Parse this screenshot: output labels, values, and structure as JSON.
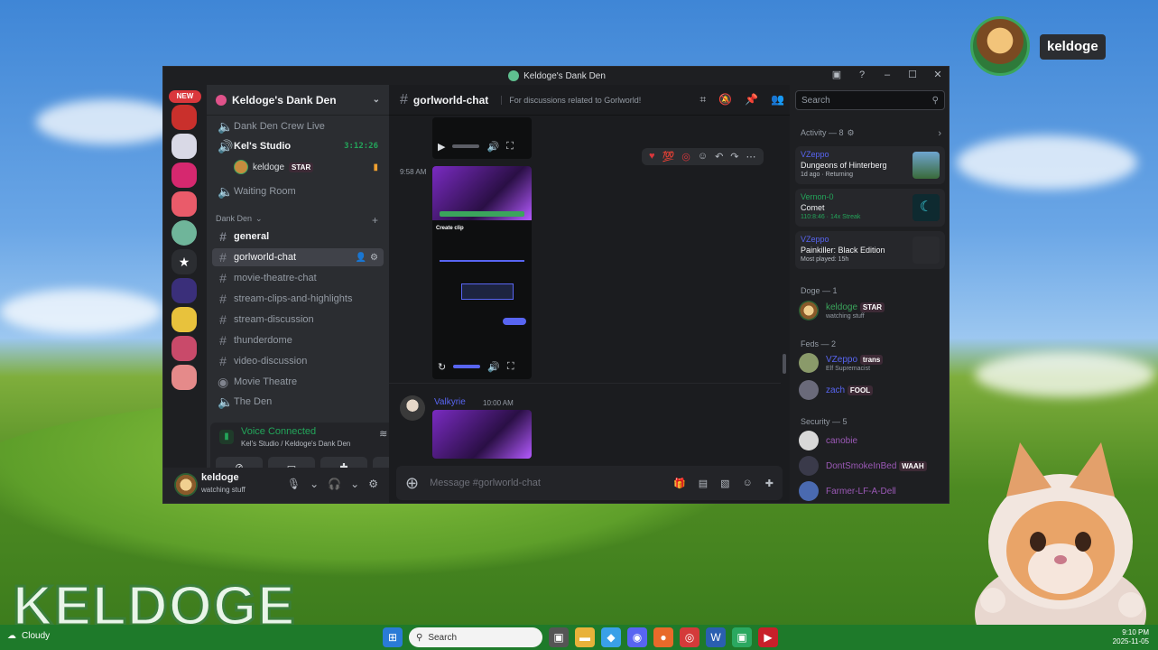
{
  "stream_overlay": {
    "username": "keldoge",
    "brand_text": "KELDOGE"
  },
  "taskbar": {
    "weather": "Cloudy",
    "search_placeholder": "Search",
    "time": "9:10 PM",
    "date": "2025-11-05"
  },
  "window": {
    "title": "Keldoge's Dank Den"
  },
  "rail": {
    "new_badge": "NEW"
  },
  "sidebar": {
    "server_name": "Keldoge's Dank Den",
    "voice_channels_top": [
      {
        "name": "Dank Den Crew Live"
      },
      {
        "name": "Kel's Studio",
        "timer": "3:12:26"
      }
    ],
    "voice_user": {
      "name": "keldoge",
      "tag": "STAR"
    },
    "waiting_room": "Waiting Room",
    "category": "Dank Den",
    "channels": [
      {
        "name": "general"
      },
      {
        "name": "gorlworld-chat"
      },
      {
        "name": "movie-theatre-chat"
      },
      {
        "name": "stream-clips-and-highlights"
      },
      {
        "name": "stream-discussion"
      },
      {
        "name": "thunderdome"
      },
      {
        "name": "video-discussion"
      },
      {
        "name": "Movie Theatre"
      },
      {
        "name": "The Den"
      }
    ]
  },
  "voice_panel": {
    "status": "Voice Connected",
    "location": "Kel's Studio / Keldoge's Dank Den"
  },
  "user_bar": {
    "name": "keldoge",
    "status": "watching stuff"
  },
  "chat": {
    "channel": "gorlworld-chat",
    "topic": "For discussions related to Gorlworld!",
    "message_placeholder": "Message #gorlworld-chat",
    "messages": [
      {
        "time": "9:58 AM",
        "clip_title": "Create clip"
      },
      {
        "author": "Valkyrie",
        "time": "10:00 AM"
      }
    ]
  },
  "right_panel": {
    "search_placeholder": "Search",
    "activity_header": "Activity — 8",
    "activities": [
      {
        "user": "VZeppo",
        "game": "Dungeons of Hinterberg",
        "meta": "1d ago · Returning"
      },
      {
        "user": "Vernon-0",
        "game": "Comet",
        "meta": "110:8:46 · 14x Streak"
      },
      {
        "user": "VZeppo",
        "game": "Painkiller: Black Edition",
        "meta": "Most played: 15h"
      }
    ],
    "sections": [
      {
        "title": "Doge — 1",
        "members": [
          {
            "name": "keldoge",
            "tag": "STAR",
            "sub": "watching stuff",
            "color": "#3ba55c"
          }
        ]
      },
      {
        "title": "Feds — 2",
        "members": [
          {
            "name": "VZeppo",
            "tag": "trans",
            "sub": "Elf Supremacist",
            "color": "#5865f2"
          },
          {
            "name": "zach",
            "tag": "FOOL",
            "sub": "",
            "color": "#5865f2"
          }
        ]
      },
      {
        "title": "Security — 5",
        "members": [
          {
            "name": "canobie",
            "tag": "",
            "sub": "",
            "color": "#9b59b6"
          },
          {
            "name": "DontSmokeInBed",
            "tag": "WAAH",
            "sub": "",
            "color": "#9b59b6"
          },
          {
            "name": "Farmer-LF-A-Dell",
            "tag": "",
            "sub": "",
            "color": "#9b59b6"
          }
        ]
      }
    ]
  }
}
